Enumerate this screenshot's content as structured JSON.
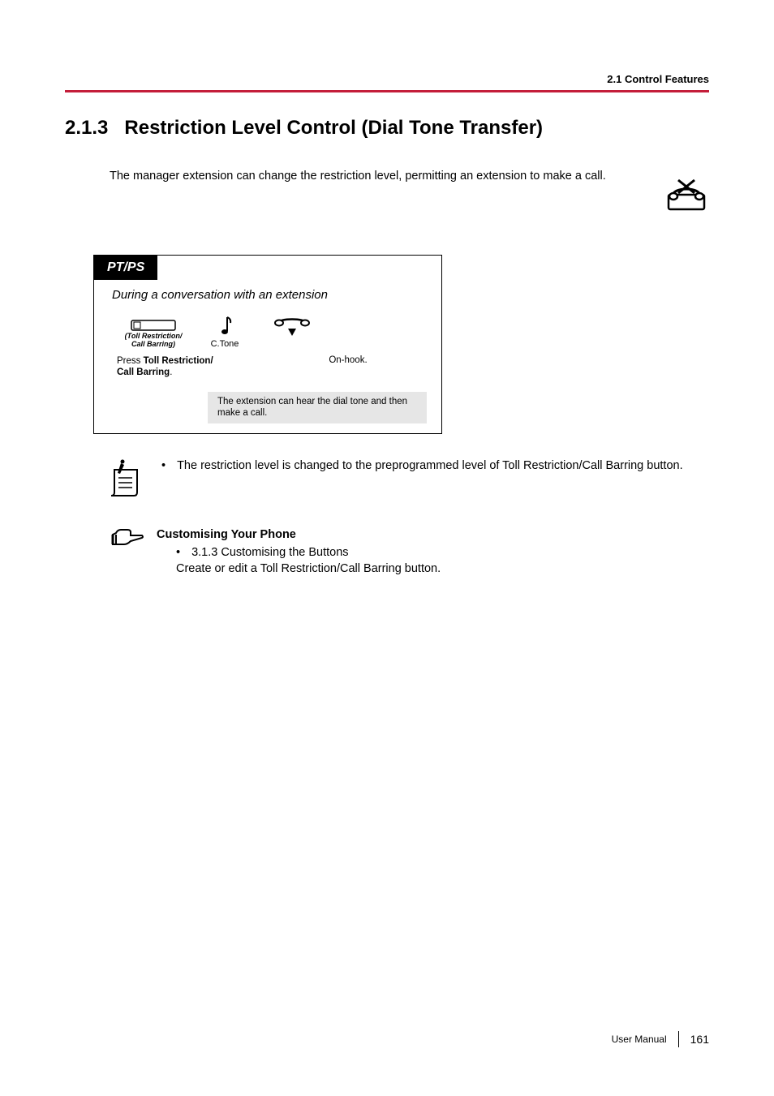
{
  "header": {
    "breadcrumb": "2.1 Control Features"
  },
  "section": {
    "number": "2.1.3",
    "title": "Restriction Level Control (Dial Tone Transfer)"
  },
  "intro": "The manager extension can change the restriction level, permitting an extension to make a call.",
  "procedure": {
    "badge": "PT/PS",
    "subtitle": "During a conversation with an extension",
    "button_label_line1": "(Toll Restriction/",
    "button_label_line2": "Call Barring)",
    "ctone_label": "C.Tone",
    "caption_left_prefix": "Press ",
    "caption_left_bold": "Toll Restriction/ Call Barring",
    "caption_left_suffix": ".",
    "caption_right": "On-hook.",
    "gray_note": "The extension can hear the dial tone and then make a call."
  },
  "note": {
    "text": "The restriction level is changed to the preprogrammed level of Toll Restriction/Call Barring button."
  },
  "customising": {
    "heading": "Customising Your Phone",
    "item": "3.1.3 Customising the Buttons",
    "desc": "Create or edit a Toll Restriction/Call Barring button."
  },
  "footer": {
    "manual": "User Manual",
    "page": "161"
  }
}
